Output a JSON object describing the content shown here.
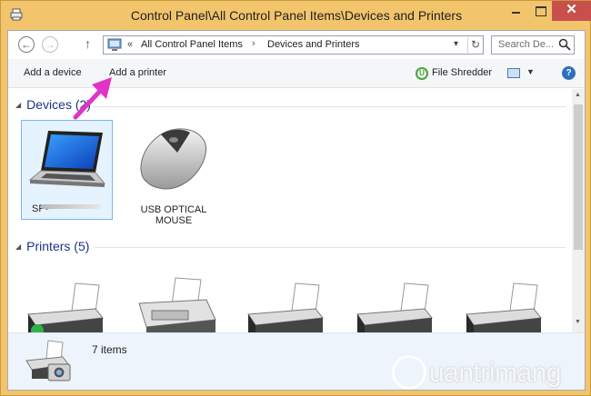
{
  "window": {
    "title": "Control Panel\\All Control Panel Items\\Devices and Printers",
    "close_label": "✕"
  },
  "navigation": {
    "back_icon": "back-arrow-icon",
    "forward_icon": "forward-arrow-icon",
    "up_icon": "up-arrow-icon",
    "overflow_chevron": "«",
    "breadcrumbs": [
      "All Control Panel Items",
      "Devices and Printers"
    ],
    "breadcrumb_separator": "›",
    "search_placeholder": "Search De..."
  },
  "commandbar": {
    "add_device": "Add a device",
    "add_printer": "Add a printer",
    "file_shredder": "File Shredder",
    "help": "?"
  },
  "groups": {
    "devices": {
      "header": "Devices (2)",
      "items": [
        {
          "label": "SP-",
          "icon": "laptop-icon",
          "selected": true
        },
        {
          "label": "USB OPTICAL\nMOUSE",
          "icon": "mouse-icon",
          "selected": false
        }
      ]
    },
    "printers": {
      "header": "Printers (5)",
      "items": [
        {
          "icon": "printer-icon",
          "default": true
        },
        {
          "icon": "fax-icon"
        },
        {
          "icon": "printer-icon"
        },
        {
          "icon": "printer-icon"
        },
        {
          "icon": "printer-icon"
        }
      ]
    }
  },
  "details": {
    "count": "7 items",
    "icon": "printer-camera-icon"
  },
  "watermark": {
    "text": "uantrimang"
  },
  "colors": {
    "title_bar": "#f2c46c",
    "close_button": "#c7504d",
    "group_header": "#1e3287",
    "selection": "#e5f3ff",
    "annotation_arrow": "#e233c6"
  }
}
